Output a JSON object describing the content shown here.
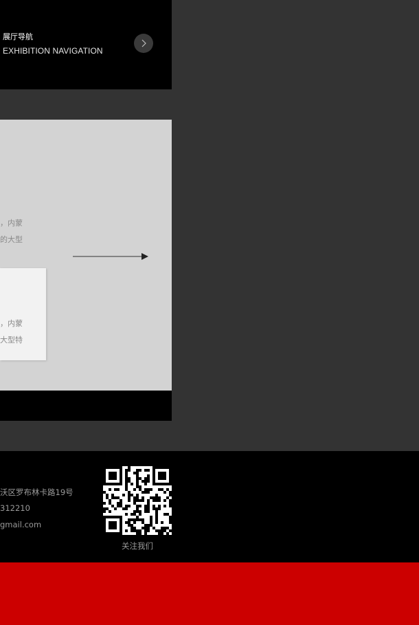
{
  "nav": {
    "title": "展厅导航",
    "subtitle": "EXHIBITION NAVIGATION",
    "arrow_icon": "chevron-right-icon"
  },
  "gallery": {
    "line1": "，内蒙",
    "line2": "的大型",
    "card_line1": "，内蒙",
    "card_line2": "大型特",
    "arrow_icon": "arrow-right-icon"
  },
  "footer": {
    "address": "沃区罗布林卡路19号",
    "phone": "312210",
    "email": "gmail.com",
    "qr_caption": "关注我们"
  },
  "colors": {
    "page_bg": "#333333",
    "panel_black": "#000000",
    "gallery_bg": "#d3d3d3",
    "card_bg": "#f2f2f2",
    "accent_red": "#cc0000"
  }
}
